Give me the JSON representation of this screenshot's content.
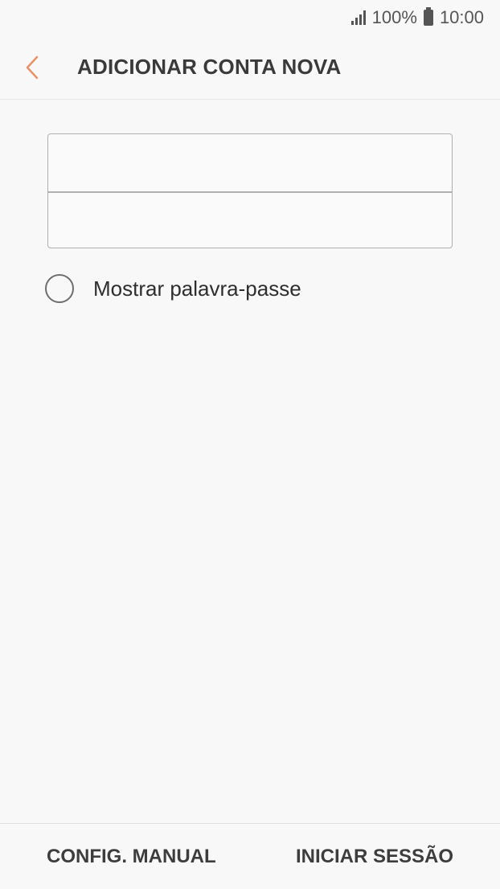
{
  "status_bar": {
    "battery_level": "100%",
    "time": "10:00",
    "signal_icon": "signal-bars-icon",
    "battery_icon": "battery-icon"
  },
  "header": {
    "title": "ADICIONAR CONTA NOVA",
    "back_icon": "chevron-left-icon",
    "accent_color": "#e8926a"
  },
  "form": {
    "email": {
      "value": "",
      "placeholder": ""
    },
    "password": {
      "value": "",
      "placeholder": ""
    },
    "show_password_label": "Mostrar palavra-passe",
    "show_password_checked": false
  },
  "footer": {
    "manual_setup_label": "CONFIG. MANUAL",
    "sign_in_label": "INICIAR SESSÃO"
  }
}
